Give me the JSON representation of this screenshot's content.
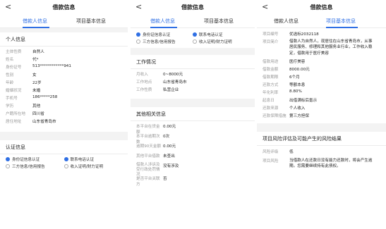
{
  "panel1": {
    "back_glyph": "<",
    "title": "借款信息",
    "tabs": [
      "借款人信息",
      "项目基本信息"
    ],
    "personal": {
      "heading": "个人信息",
      "rows": [
        {
          "label": "主体性质",
          "value": "自然人"
        },
        {
          "label": "姓名",
          "value": "代*"
        },
        {
          "label": "身份证号",
          "value": "513************941"
        },
        {
          "label": "性别",
          "value": "女"
        },
        {
          "label": "年龄",
          "value": "22岁"
        },
        {
          "label": "婚姻状况",
          "value": "未婚"
        },
        {
          "label": "手机号",
          "value": "186*****258"
        },
        {
          "label": "学历",
          "value": "其他"
        },
        {
          "label": "户籍所在地",
          "value": "四川省"
        },
        {
          "label": "居住地址",
          "value": "山东省青岛市"
        }
      ]
    },
    "auth": {
      "heading": "认证信息",
      "items": [
        {
          "label": "身份证信息认证",
          "checked": true
        },
        {
          "label": "联系电话认证",
          "checked": true
        },
        {
          "label": "三方信息/信用报告",
          "checked": false
        },
        {
          "label": "收入证明/财力证明",
          "checked": false
        }
      ]
    }
  },
  "panel2": {
    "back_glyph": "<",
    "title": "借款信息",
    "tabs": [
      "借款人信息",
      "项目基本信息"
    ],
    "auth": {
      "items": [
        {
          "label": "身份证信息认证",
          "checked": true
        },
        {
          "label": "联系电话认证",
          "checked": true
        },
        {
          "label": "三方信息/信用报告",
          "checked": false
        },
        {
          "label": "收入证明/财力证明",
          "checked": false
        }
      ]
    },
    "work": {
      "heading": "工作情况",
      "rows": [
        {
          "label": "月收入",
          "value": "0~8000元"
        },
        {
          "label": "工作地点",
          "value": "山东省青岛市"
        },
        {
          "label": "工作性质",
          "value": "私营企业"
        }
      ]
    },
    "other": {
      "heading": "其他相关信息",
      "rows": [
        {
          "label": "本平台在贷金额",
          "value": "0.00元"
        },
        {
          "label": "本平台逾期次数",
          "value": "0次"
        },
        {
          "label": "逾期90天金额",
          "value": "0.00元"
        },
        {
          "label": "其他平台借款",
          "value": "未查出"
        },
        {
          "label": "借款人涉诉及受行政处罚情况",
          "value": "没有涉及"
        },
        {
          "label": "是否平台关联方",
          "value": "否"
        }
      ]
    }
  },
  "panel3": {
    "back_glyph": "<",
    "title": "借款信息",
    "tabs": [
      "借款人信息",
      "项目基本信息"
    ],
    "project": {
      "rows": [
        {
          "label": "项目编号",
          "value": "优选标2032118"
        },
        {
          "label": "项目简介",
          "value": "借款人为自然人，现居住在山东省青岛市，从事居民服务、修理和其他服务业行业，工作收入稳定，借款用于医疗美容"
        },
        {
          "label": "借款用途",
          "value": "医疗美容"
        },
        {
          "label": "借款金额",
          "value": "8000.00元"
        },
        {
          "label": "借款期限",
          "value": "6个月"
        },
        {
          "label": "还款方式",
          "value": "等额本息"
        },
        {
          "label": "年化利率",
          "value": "8.80%"
        },
        {
          "label": "起息日",
          "value": "出借满标后氪示"
        },
        {
          "label": "还款来源",
          "value": "个人收入"
        },
        {
          "label": "还款保障措施",
          "value": "第三方担保"
        }
      ]
    },
    "risk": {
      "heading": "项目风险评估及可能产生的风险结果",
      "rows": [
        {
          "label": "风险评级",
          "value": "低"
        },
        {
          "label": "项目风险",
          "value": "当借款人在还款日没有能力还款时，将会产生逾期。您需要继续持有此债权。"
        }
      ]
    }
  },
  "colors": {
    "accent": "#2f6fe4",
    "label": "#999999",
    "text": "#222222",
    "divider": "#ececec"
  }
}
